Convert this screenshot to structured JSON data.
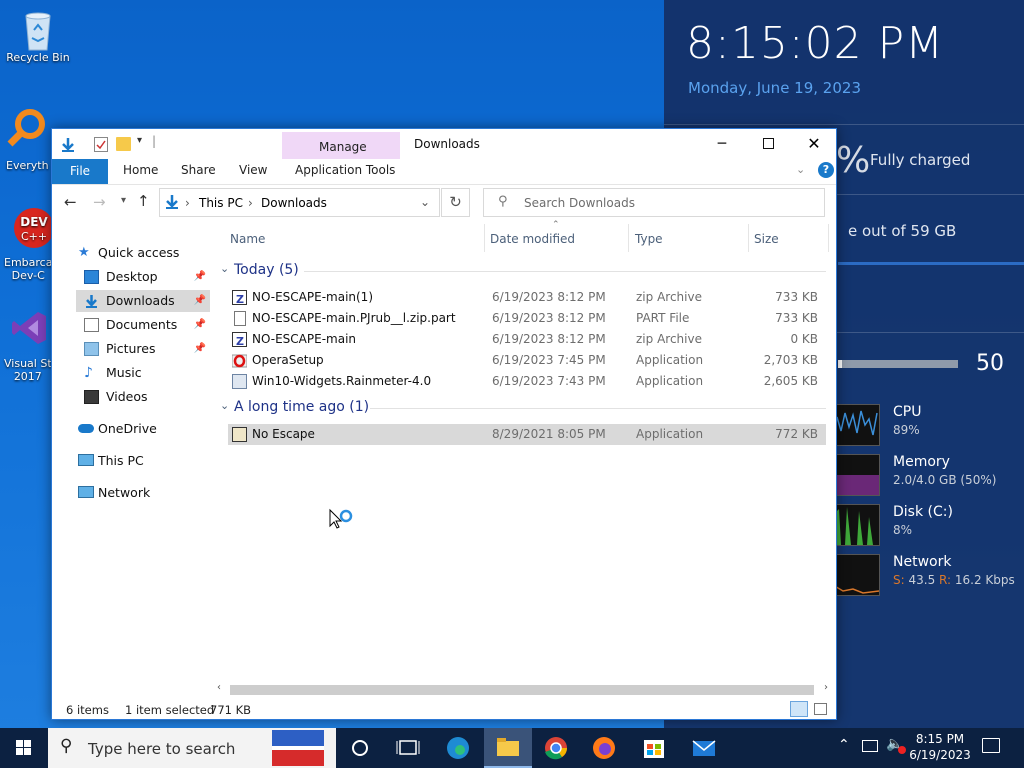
{
  "desktop": {
    "icons": [
      {
        "label": "Recycle Bin"
      },
      {
        "label": "Everyth"
      },
      {
        "label": "Embarca\nDev-C"
      },
      {
        "label": "Visual St\n2017"
      }
    ]
  },
  "widgets": {
    "time": "8:15:02 PM",
    "date": "Monday, June 19, 2023",
    "battery_pct_glyph": "%",
    "battery_status": "Fully charged",
    "storage_text": "e out of 59 GB",
    "volume_value": "50",
    "volume_level": 0.03,
    "cpu": {
      "label": "CPU",
      "value": "89%"
    },
    "memory": {
      "label": "Memory",
      "value": "2.0/4.0 GB (50%)"
    },
    "disk": {
      "label": "Disk (C:)",
      "value": "8%"
    },
    "network": {
      "label": "Network",
      "send_prefix": "S:",
      "send_value": "43.5",
      "recv_prefix": "R:",
      "recv_value": "16.2 Kbps"
    }
  },
  "explorer": {
    "title": "Downloads",
    "context_tab": "Manage",
    "tabs": [
      "File",
      "Home",
      "Share",
      "View",
      "Application Tools"
    ],
    "breadcrumb": [
      "This PC",
      "Downloads"
    ],
    "search_placeholder": "Search Downloads",
    "nav": [
      {
        "label": "Quick access",
        "pinned": false
      },
      {
        "label": "Desktop",
        "pinned": true
      },
      {
        "label": "Downloads",
        "pinned": true,
        "selected": true
      },
      {
        "label": "Documents",
        "pinned": true
      },
      {
        "label": "Pictures",
        "pinned": true
      },
      {
        "label": "Music",
        "pinned": false
      },
      {
        "label": "Videos",
        "pinned": false
      },
      {
        "label": "OneDrive",
        "pinned": false
      },
      {
        "label": "This PC",
        "pinned": false
      },
      {
        "label": "Network",
        "pinned": false
      }
    ],
    "columns": [
      "Name",
      "Date modified",
      "Type",
      "Size"
    ],
    "groups": [
      {
        "label": "Today (5)",
        "files": [
          {
            "name": "NO-ESCAPE-main(1)",
            "date": "6/19/2023 8:12 PM",
            "type": "zip Archive",
            "size": "733 KB",
            "icon": "zip-icon"
          },
          {
            "name": "NO-ESCAPE-main.PJrub__l.zip.part",
            "date": "6/19/2023 8:12 PM",
            "type": "PART File",
            "size": "733 KB",
            "icon": "file-icon"
          },
          {
            "name": "NO-ESCAPE-main",
            "date": "6/19/2023 8:12 PM",
            "type": "zip Archive",
            "size": "0 KB",
            "icon": "zip-icon"
          },
          {
            "name": "OperaSetup",
            "date": "6/19/2023 7:45 PM",
            "type": "Application",
            "size": "2,703 KB",
            "icon": "opera-icon"
          },
          {
            "name": "Win10-Widgets.Rainmeter-4.0",
            "date": "6/19/2023 7:43 PM",
            "type": "Application",
            "size": "2,605 KB",
            "icon": "installer-icon"
          }
        ]
      },
      {
        "label": "A long time ago (1)",
        "files": [
          {
            "name": "No Escape",
            "date": "8/29/2021 8:05 PM",
            "type": "Application",
            "size": "772 KB",
            "icon": "app-icon",
            "selected": true
          }
        ]
      }
    ],
    "status": {
      "items": "6 items",
      "selected": "1 item selected",
      "size": "771 KB"
    }
  },
  "taskbar": {
    "search_placeholder": "Type here to search",
    "clock_time": "8:15 PM",
    "clock_date": "6/19/2023"
  },
  "colors": {
    "accent": "#1979ca",
    "manage_tab": "#f0d8f7",
    "selected_row": "#d9d9d9",
    "taskbar": "#0c2141"
  }
}
